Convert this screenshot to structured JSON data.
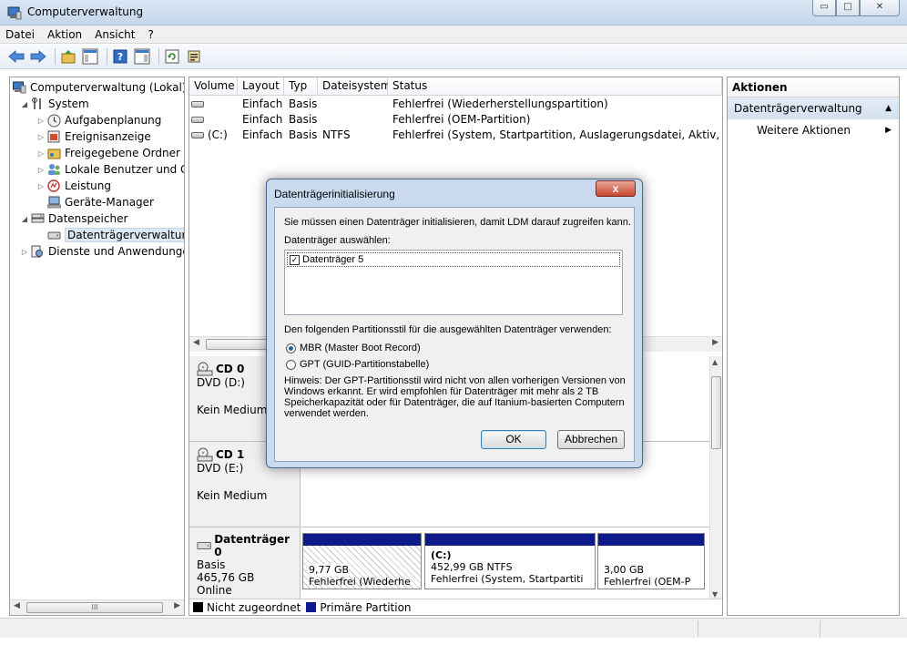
{
  "window": {
    "title": "Computerverwaltung",
    "min": "▭",
    "max": "□",
    "close": "✕"
  },
  "menu": [
    "Datei",
    "Aktion",
    "Ansicht",
    "?"
  ],
  "tree": {
    "root": "Computerverwaltung (Lokal)",
    "system": "System",
    "aufgabenplanung": "Aufgabenplanung",
    "ereignisanzeige": "Ereignisanzeige",
    "freigegebene_ordner": "Freigegebene Ordner",
    "lokale_benutzer": "Lokale Benutzer und Gr",
    "leistung": "Leistung",
    "geraete_manager": "Geräte-Manager",
    "datenspeicher": "Datenspeicher",
    "datentraegerverwaltung": "Datenträgerverwaltung",
    "dienste": "Dienste und Anwendungen",
    "scroll_mid": "III"
  },
  "volume_table": {
    "headers": [
      "Volume",
      "Layout",
      "Typ",
      "Dateisystem",
      "Status"
    ],
    "rows": [
      {
        "volume": "",
        "layout": "Einfach",
        "typ": "Basis",
        "fs": "",
        "status": "Fehlerfrei (Wiederherstellungspartition)"
      },
      {
        "volume": "",
        "layout": "Einfach",
        "typ": "Basis",
        "fs": "",
        "status": "Fehlerfrei (OEM-Partition)"
      },
      {
        "volume": "(C:)",
        "layout": "Einfach",
        "typ": "Basis",
        "fs": "NTFS",
        "status": "Fehlerfrei (System, Startpartition, Auslagerungsdatei, Aktiv, Absturzab"
      }
    ]
  },
  "disks": {
    "cd0": {
      "name": "CD 0",
      "type": "DVD (D:)",
      "state": "Kein Medium"
    },
    "cd1": {
      "name": "CD 1",
      "type": "DVD (E:)",
      "state": "Kein Medium"
    },
    "disk0": {
      "name": "Datenträger 0",
      "kind": "Basis",
      "size": "465,76 GB",
      "state": "Online",
      "partitions": [
        {
          "title": "",
          "size": "9,77 GB",
          "status": "Fehlerfrei (Wiederhe"
        },
        {
          "title": "(C:)",
          "size": "452,99 GB NTFS",
          "status": "Fehlerfrei (System, Startpartiti"
        },
        {
          "title": "",
          "size": "3,00 GB",
          "status": "Fehlerfrei (OEM-P"
        }
      ]
    }
  },
  "legend": {
    "unallocated": "Nicht zugeordnet",
    "primary": "Primäre Partition",
    "unallocated_color": "#000000",
    "primary_color": "#0f1a8a"
  },
  "actions": {
    "header": "Aktionen",
    "section": "Datenträgerverwaltung",
    "more": "Weitere Aktionen"
  },
  "dialog": {
    "title": "Datenträgerinitialisierung",
    "intro": "Sie müssen einen Datenträger initialisieren, damit LDM darauf zugreifen kann.",
    "select_label": "Datenträger auswählen:",
    "disk_entry": "Datenträger 5",
    "style_label": "Den folgenden Partitionsstil für die ausgewählten Datenträger verwenden:",
    "mbr": "MBR (Master Boot Record)",
    "gpt": "GPT (GUID-Partitionstabelle)",
    "hint1": "Hinweis: Der GPT-Partitionsstil wird nicht von allen vorherigen Versionen von",
    "hint2": "Windows erkannt. Er wird empfohlen für Datenträger mit mehr als 2 TB",
    "hint3": "Speicherkapazität oder für Datenträger, die auf Itanium-basierten Computern",
    "hint4": "verwendet werden.",
    "ok": "OK",
    "cancel": "Abbrechen",
    "close": "x"
  }
}
